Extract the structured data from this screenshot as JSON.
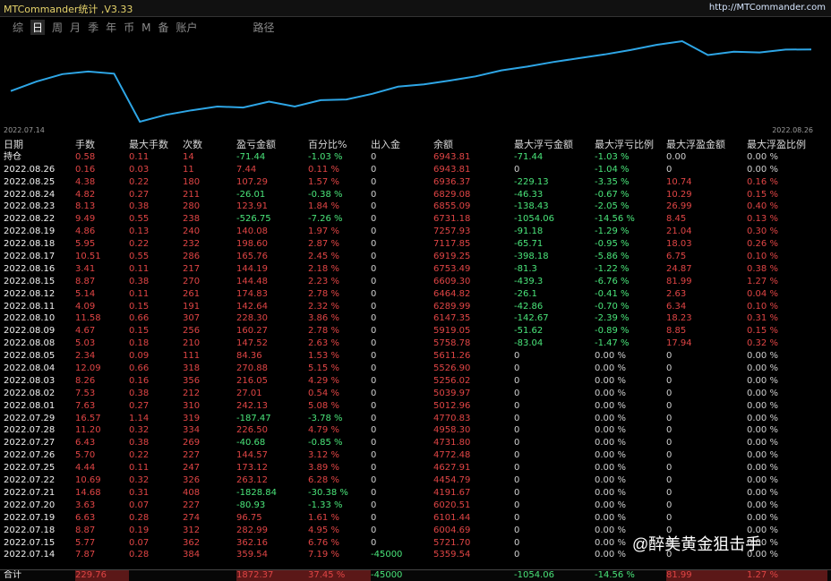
{
  "app": {
    "title": "MTCommander统计 ,V3.33",
    "url": "http://MTCommander.com"
  },
  "tabs": [
    {
      "label": "综"
    },
    {
      "label": "日"
    },
    {
      "label": "周"
    },
    {
      "label": "月"
    },
    {
      "label": "季"
    },
    {
      "label": "年"
    },
    {
      "label": "币"
    },
    {
      "label": "M"
    },
    {
      "label": "备"
    },
    {
      "label": "账户"
    },
    {
      "label": "路径"
    }
  ],
  "active_tab_index": 1,
  "chart": {
    "start_label": "2022.07.14",
    "end_label": "2022.08.26",
    "line_color": "#2ea6e6",
    "points": [
      5359.54,
      5721.7,
      6004.69,
      6101.44,
      6020.51,
      4191.67,
      4454.79,
      4627.91,
      4772.48,
      4731.8,
      4958.3,
      4770.83,
      5012.96,
      5039.97,
      5256.02,
      5526.9,
      5611.26,
      5758.78,
      5919.05,
      6147.35,
      6289.99,
      6464.82,
      6609.3,
      6753.49,
      6919.25,
      7117.85,
      7257.93,
      6731.18,
      6855.09,
      6829.08,
      6936.37,
      6943.81
    ]
  },
  "table": {
    "headers": [
      "日期",
      "手数",
      "最大手数",
      "次数",
      "盈亏金额",
      "百分比%",
      "出入金",
      "余额",
      "最大浮亏金额",
      "最大浮亏比例",
      "最大浮盈金额",
      "最大浮盈比例"
    ],
    "rows": [
      [
        "持仓",
        "0.58",
        "0.11",
        "14",
        "-71.44",
        "-1.03 %",
        "0",
        "6943.81",
        "-71.44",
        "-1.03 %",
        "0.00",
        "0.00 %"
      ],
      [
        "2022.08.26",
        "0.16",
        "0.03",
        "11",
        "7.44",
        "0.11 %",
        "0",
        "6943.81",
        "0",
        "-1.04 %",
        "0",
        "0.00 %"
      ],
      [
        "2022.08.25",
        "4.38",
        "0.22",
        "180",
        "107.29",
        "1.57 %",
        "0",
        "6936.37",
        "-229.13",
        "-3.35 %",
        "10.74",
        "0.16 %"
      ],
      [
        "2022.08.24",
        "4.82",
        "0.27",
        "211",
        "-26.01",
        "-0.38 %",
        "0",
        "6829.08",
        "-46.33",
        "-0.67 %",
        "10.29",
        "0.15 %"
      ],
      [
        "2022.08.23",
        "8.13",
        "0.38",
        "280",
        "123.91",
        "1.84 %",
        "0",
        "6855.09",
        "-138.43",
        "-2.05 %",
        "26.99",
        "0.40 %"
      ],
      [
        "2022.08.22",
        "9.49",
        "0.55",
        "238",
        "-526.75",
        "-7.26 %",
        "0",
        "6731.18",
        "-1054.06",
        "-14.56 %",
        "8.45",
        "0.13 %"
      ],
      [
        "2022.08.19",
        "4.86",
        "0.13",
        "240",
        "140.08",
        "1.97 %",
        "0",
        "7257.93",
        "-91.18",
        "-1.29 %",
        "21.04",
        "0.30 %"
      ],
      [
        "2022.08.18",
        "5.95",
        "0.22",
        "232",
        "198.60",
        "2.87 %",
        "0",
        "7117.85",
        "-65.71",
        "-0.95 %",
        "18.03",
        "0.26 %"
      ],
      [
        "2022.08.17",
        "10.51",
        "0.55",
        "286",
        "165.76",
        "2.45 %",
        "0",
        "6919.25",
        "-398.18",
        "-5.86 %",
        "6.75",
        "0.10 %"
      ],
      [
        "2022.08.16",
        "3.41",
        "0.11",
        "217",
        "144.19",
        "2.18 %",
        "0",
        "6753.49",
        "-81.3",
        "-1.22 %",
        "24.87",
        "0.38 %"
      ],
      [
        "2022.08.15",
        "8.87",
        "0.38",
        "270",
        "144.48",
        "2.23 %",
        "0",
        "6609.30",
        "-439.3",
        "-6.76 %",
        "81.99",
        "1.27 %"
      ],
      [
        "2022.08.12",
        "5.14",
        "0.11",
        "261",
        "174.83",
        "2.78 %",
        "0",
        "6464.82",
        "-26.1",
        "-0.41 %",
        "2.63",
        "0.04 %"
      ],
      [
        "2022.08.11",
        "4.09",
        "0.15",
        "191",
        "142.64",
        "2.32 %",
        "0",
        "6289.99",
        "-42.86",
        "-0.70 %",
        "6.34",
        "0.10 %"
      ],
      [
        "2022.08.10",
        "11.58",
        "0.66",
        "307",
        "228.30",
        "3.86 %",
        "0",
        "6147.35",
        "-142.67",
        "-2.39 %",
        "18.23",
        "0.31 %"
      ],
      [
        "2022.08.09",
        "4.67",
        "0.15",
        "256",
        "160.27",
        "2.78 %",
        "0",
        "5919.05",
        "-51.62",
        "-0.89 %",
        "8.85",
        "0.15 %"
      ],
      [
        "2022.08.08",
        "5.03",
        "0.18",
        "210",
        "147.52",
        "2.63 %",
        "0",
        "5758.78",
        "-83.04",
        "-1.47 %",
        "17.94",
        "0.32 %"
      ],
      [
        "2022.08.05",
        "2.34",
        "0.09",
        "111",
        "84.36",
        "1.53 %",
        "0",
        "5611.26",
        "0",
        "0.00 %",
        "0",
        "0.00 %"
      ],
      [
        "2022.08.04",
        "12.09",
        "0.66",
        "318",
        "270.88",
        "5.15 %",
        "0",
        "5526.90",
        "0",
        "0.00 %",
        "0",
        "0.00 %"
      ],
      [
        "2022.08.03",
        "8.26",
        "0.16",
        "356",
        "216.05",
        "4.29 %",
        "0",
        "5256.02",
        "0",
        "0.00 %",
        "0",
        "0.00 %"
      ],
      [
        "2022.08.02",
        "7.53",
        "0.38",
        "212",
        "27.01",
        "0.54 %",
        "0",
        "5039.97",
        "0",
        "0.00 %",
        "0",
        "0.00 %"
      ],
      [
        "2022.08.01",
        "7.63",
        "0.27",
        "310",
        "242.13",
        "5.08 %",
        "0",
        "5012.96",
        "0",
        "0.00 %",
        "0",
        "0.00 %"
      ],
      [
        "2022.07.29",
        "16.57",
        "1.14",
        "319",
        "-187.47",
        "-3.78 %",
        "0",
        "4770.83",
        "0",
        "0.00 %",
        "0",
        "0.00 %"
      ],
      [
        "2022.07.28",
        "11.20",
        "0.32",
        "334",
        "226.50",
        "4.79 %",
        "0",
        "4958.30",
        "0",
        "0.00 %",
        "0",
        "0.00 %"
      ],
      [
        "2022.07.27",
        "6.43",
        "0.38",
        "269",
        "-40.68",
        "-0.85 %",
        "0",
        "4731.80",
        "0",
        "0.00 %",
        "0",
        "0.00 %"
      ],
      [
        "2022.07.26",
        "5.70",
        "0.22",
        "227",
        "144.57",
        "3.12 %",
        "0",
        "4772.48",
        "0",
        "0.00 %",
        "0",
        "0.00 %"
      ],
      [
        "2022.07.25",
        "4.44",
        "0.11",
        "247",
        "173.12",
        "3.89 %",
        "0",
        "4627.91",
        "0",
        "0.00 %",
        "0",
        "0.00 %"
      ],
      [
        "2022.07.22",
        "10.69",
        "0.32",
        "326",
        "263.12",
        "6.28 %",
        "0",
        "4454.79",
        "0",
        "0.00 %",
        "0",
        "0.00 %"
      ],
      [
        "2022.07.21",
        "14.68",
        "0.31",
        "408",
        "-1828.84",
        "-30.38 %",
        "0",
        "4191.67",
        "0",
        "0.00 %",
        "0",
        "0.00 %"
      ],
      [
        "2022.07.20",
        "3.63",
        "0.07",
        "227",
        "-80.93",
        "-1.33 %",
        "0",
        "6020.51",
        "0",
        "0.00 %",
        "0",
        "0.00 %"
      ],
      [
        "2022.07.19",
        "6.63",
        "0.28",
        "274",
        "96.75",
        "1.61 %",
        "0",
        "6101.44",
        "0",
        "0.00 %",
        "0",
        "0.00 %"
      ],
      [
        "2022.07.18",
        "8.87",
        "0.19",
        "312",
        "282.99",
        "4.95 %",
        "0",
        "6004.69",
        "0",
        "0.00 %",
        "0",
        "0.00 %"
      ],
      [
        "2022.07.15",
        "5.77",
        "0.07",
        "362",
        "362.16",
        "6.76 %",
        "0",
        "5721.70",
        "0",
        "0.00 %",
        "0",
        "0.00 %"
      ],
      [
        "2022.07.14",
        "7.87",
        "0.28",
        "384",
        "359.54",
        "7.19 %",
        "-45000",
        "5359.54",
        "0",
        "0.00 %",
        "0",
        "0.00 %"
      ]
    ],
    "summary": [
      "合计",
      "229.76",
      "",
      "",
      "1872.37",
      "37.45 %",
      "-45000",
      "",
      "-1054.06",
      "-14.56 %",
      "81.99",
      "1.27 %"
    ]
  },
  "watermark": "@醉美黄金狙击手"
}
